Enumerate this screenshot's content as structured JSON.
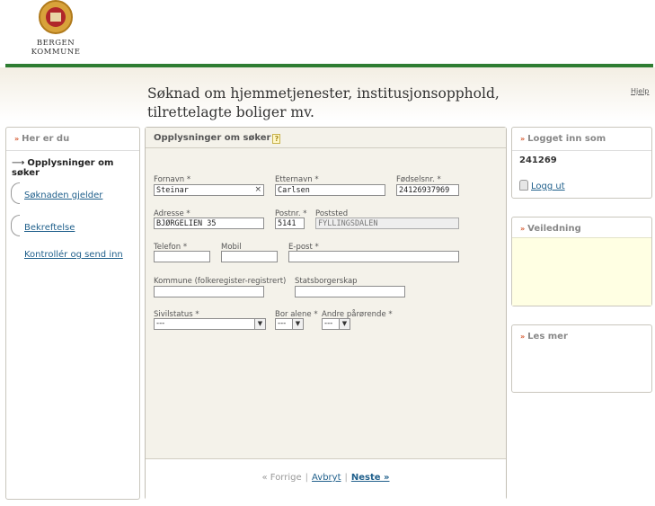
{
  "logo": {
    "line1": "BERGEN",
    "line2": "KOMMUNE"
  },
  "header": {
    "title_line1": "Søknad om hjemmetjenester, institusjonsopphold,",
    "title_line2": "tilrettelagte boliger mv.",
    "help": "Hjelp"
  },
  "left_nav": {
    "title": "Her er du",
    "current_marker": "⟶",
    "current": "Opplysninger om søker",
    "items": [
      "Søknaden gjelder",
      "Bekreftelse",
      "Kontrollér og send inn"
    ]
  },
  "form": {
    "title": "Opplysninger om søker",
    "help_icon": "?",
    "fields": {
      "fornavn": {
        "label": "Fornavn *",
        "value": "Steinar",
        "clear": "×"
      },
      "etternavn": {
        "label": "Etternavn *",
        "value": "Carlsen"
      },
      "fodselsnr": {
        "label": "Fødselsnr. *",
        "value": "24126937969"
      },
      "adresse": {
        "label": "Adresse *",
        "value": "BJØRGELIEN 35"
      },
      "postnr": {
        "label": "Postnr. *",
        "value": "5141"
      },
      "poststed": {
        "label": "Poststed",
        "value": "FYLLINGSDALEN"
      },
      "telefon": {
        "label": "Telefon *",
        "value": ""
      },
      "mobil": {
        "label": "Mobil",
        "value": ""
      },
      "epost": {
        "label": "E-post *",
        "value": ""
      },
      "kommune": {
        "label": "Kommune (folkeregister-registrert)",
        "value": ""
      },
      "statsborgerskap": {
        "label": "Statsborgerskap",
        "value": ""
      },
      "sivilstatus": {
        "label": "Sivilstatus *",
        "value": "---"
      },
      "bor_alene": {
        "label": "Bor alene *",
        "value": "---"
      },
      "andre_parorende": {
        "label": "Andre pårørende *",
        "value": "---"
      }
    },
    "footer": {
      "prev": "« Forrige",
      "sep": "|",
      "cancel": "Avbryt",
      "next": "Neste »"
    }
  },
  "logged_in": {
    "title": "Logget inn som",
    "user": "241269",
    "logout": "Logg ut"
  },
  "guidance": {
    "title": "Veiledning"
  },
  "read_more": {
    "title": "Les mer"
  },
  "colors": {
    "accent_green": "#2e7d32",
    "link": "#1f5f8b",
    "arrow": "#d4562c",
    "guide_bg": "#ffffe3"
  },
  "icons": [
    "bergen-crest-icon",
    "question-icon",
    "lock-icon",
    "dropdown-arrow-icon"
  ]
}
